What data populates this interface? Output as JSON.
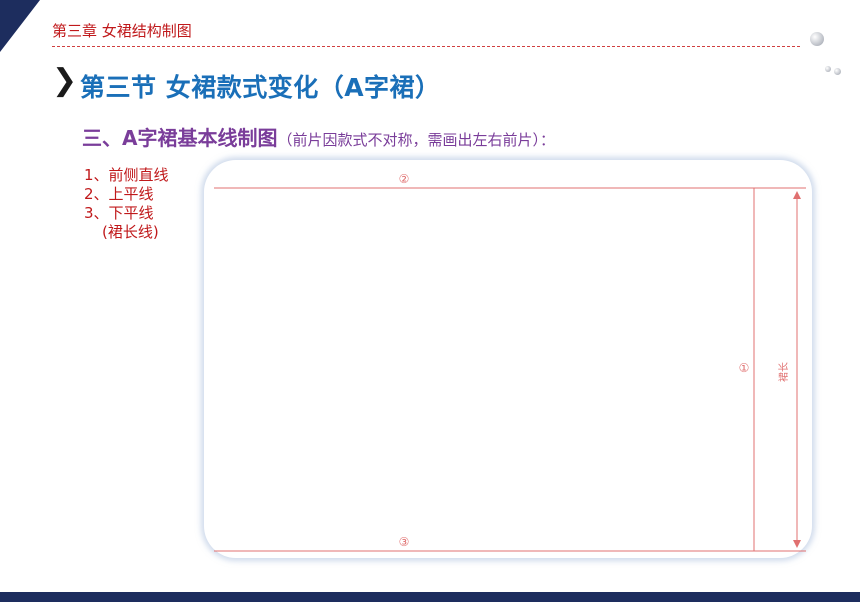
{
  "header": {
    "chapter": "第三章  女裙结构制图"
  },
  "section": {
    "title": "第三节  女裙款式变化（A字裙）"
  },
  "subheading": {
    "main": "三、A字裙基本线制图",
    "note": "（前片因款式不对称，需画出左右前片）："
  },
  "steps": [
    "1、前侧直线",
    "2、上平线",
    "3、下平线",
    "(裙长线)"
  ],
  "drawing": {
    "labels": {
      "top_line": "②",
      "side_line": "①",
      "bottom_line": "③",
      "dimension": "裙长"
    },
    "line_color": "#e07070"
  },
  "colors": {
    "accent_red": "#c0191b",
    "title_blue": "#1a6fb8",
    "subtitle_purple": "#7a3d9a",
    "navy": "#1d2d5e"
  },
  "icons": [
    "chevron-right-icon",
    "bubble-icon"
  ]
}
